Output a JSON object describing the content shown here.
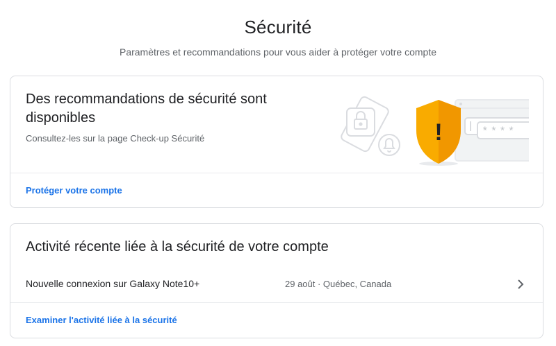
{
  "page": {
    "title": "Sécurité",
    "subtitle": "Paramètres et recommandations pour vous aider à protéger votre compte"
  },
  "recommendations": {
    "title": "Des recommandations de sécurité sont disponibles",
    "description": "Consultez-les sur la page Check-up Sécurité",
    "link": "Protéger votre compte",
    "illustration_icons": [
      "phone-lock-icon",
      "bell-icon",
      "warning-shield-icon",
      "password-window-icon"
    ],
    "password_mask": "****",
    "shield_symbol": "!"
  },
  "activity": {
    "title": "Activité récente liée à la sécurité de votre compte",
    "events": [
      {
        "label": "Nouvelle connexion sur Galaxy Note10+",
        "meta": "29 août · Québec, Canada"
      }
    ],
    "link": "Examiner l'activité liée à la sécurité"
  },
  "colors": {
    "link": "#1a73e8",
    "shield": "#f9ab00",
    "shield_dark": "#e37400",
    "border": "#dadce0"
  }
}
